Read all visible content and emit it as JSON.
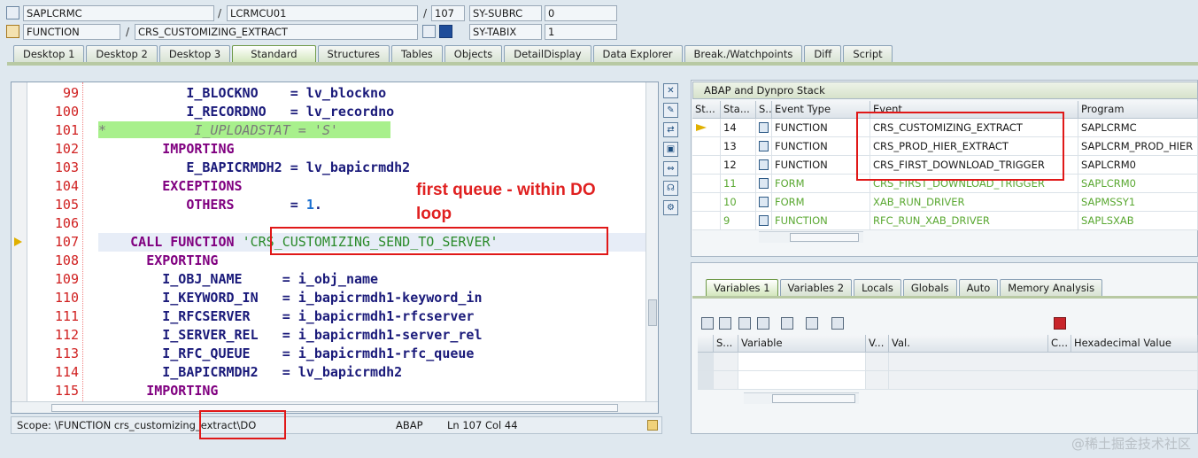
{
  "header": {
    "program": "SAPLCRMC",
    "include": "LCRMCU01",
    "line": "107",
    "subrc_label": "SY-SUBRC",
    "subrc_value": "0",
    "type": "FUNCTION",
    "object_name": "CRS_CUSTOMIZING_EXTRACT",
    "tabix_label": "SY-TABIX",
    "tabix_value": "1",
    "sep1": "/",
    "sep2": "/",
    "sep3": "/"
  },
  "tabs": [
    "Desktop 1",
    "Desktop 2",
    "Desktop 3",
    "Standard",
    "Structures",
    "Tables",
    "Objects",
    "DetailDisplay",
    "Data Explorer",
    "Break./Watchpoints",
    "Diff",
    "Script"
  ],
  "active_tab": "Standard",
  "editor": {
    "line_numbers": [
      "99",
      "100",
      "101",
      "102",
      "103",
      "104",
      "105",
      "106",
      "107",
      "108",
      "109",
      "110",
      "111",
      "112",
      "113",
      "114",
      "115"
    ],
    "current_line": "107",
    "annotation": "first queue - within DO loop",
    "annotation_line1": "first queue - within DO",
    "annotation_line2": "loop"
  },
  "status_bar": {
    "scope": "Scope: \\FUNCTION crs_customizing_extract\\DO",
    "language": "ABAP",
    "position": "Ln 107 Col  44"
  },
  "stack": {
    "title": "ABAP and Dynpro Stack",
    "columns": [
      "St...",
      "Sta...",
      "S...",
      "Event Type",
      "Event",
      "Program"
    ],
    "rows": [
      {
        "level": "14",
        "type": "FUNCTION",
        "event": "CRS_CUSTOMIZING_EXTRACT",
        "program": "SAPLCRMC"
      },
      {
        "level": "13",
        "type": "FUNCTION",
        "event": "CRS_PROD_HIER_EXTRACT",
        "program": "SAPLCRM_PROD_HIER"
      },
      {
        "level": "12",
        "type": "FUNCTION",
        "event": "CRS_FIRST_DOWNLOAD_TRIGGER",
        "program": "SAPLCRM0"
      },
      {
        "level": "11",
        "type": "FORM",
        "event": "CRS_FIRST_DOWNLOAD_TRIGGER",
        "program": "SAPLCRM0"
      },
      {
        "level": "10",
        "type": "FORM",
        "event": "XAB_RUN_DRIVER",
        "program": "SAPMSSY1"
      },
      {
        "level": "9",
        "type": "FUNCTION",
        "event": "RFC_RUN_XAB_DRIVER",
        "program": "SAPLSXAB"
      }
    ]
  },
  "variables": {
    "tabs": [
      "Variables 1",
      "Variables 2",
      "Locals",
      "Globals",
      "Auto",
      "Memory Analysis"
    ],
    "columns": [
      "S...",
      "Variable",
      "V...",
      "Val.",
      "C...",
      "Hexadecimal Value"
    ]
  },
  "watermark": "@稀土掘金技术社区",
  "colors": {
    "accent_red": "#e01818",
    "stack_green": "#5aa832",
    "line_number": "#d02020"
  }
}
